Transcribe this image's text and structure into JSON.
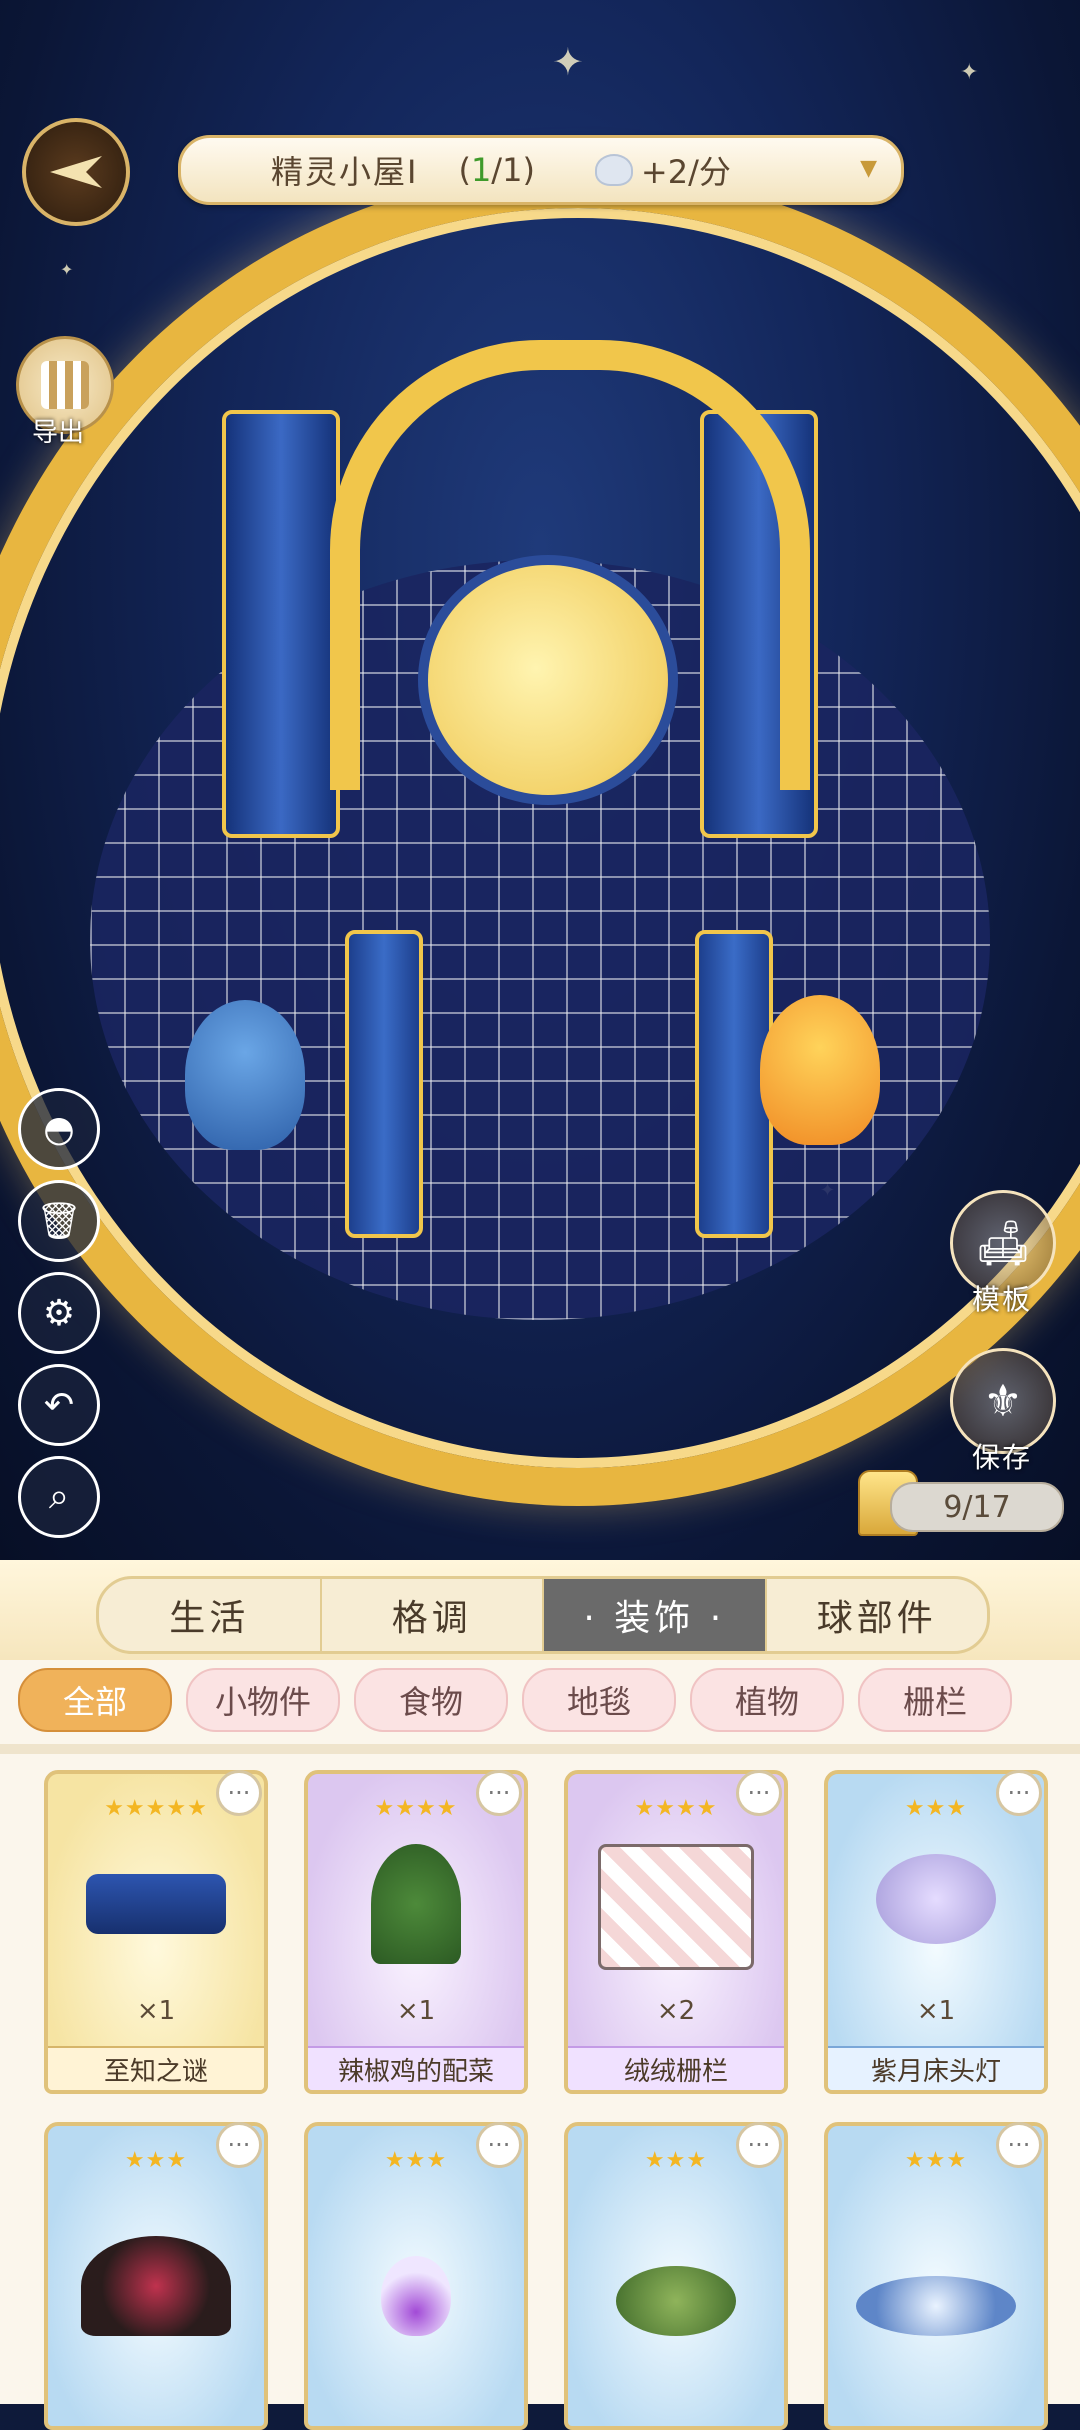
{
  "header": {
    "house_name": "精灵小屋Ⅰ",
    "count_open": "(",
    "count_current": "1",
    "count_rest": "/1)",
    "rate": "+2/分",
    "shell_icon": "shell-icon",
    "dropdown_icon": "chevron-down-icon"
  },
  "left_tools": {
    "export_label": "导出",
    "icons": [
      "back-icon",
      "qr-code-icon",
      "view-toggle-icon",
      "trash-icon",
      "gear-icon",
      "undo-icon",
      "search-icon"
    ]
  },
  "right_tools": {
    "template_label": "模板",
    "save_label": "保存"
  },
  "capacity": {
    "value": "9/17"
  },
  "tabs": [
    {
      "label": "生活"
    },
    {
      "label": "格调"
    },
    {
      "label": "· 装饰 ·"
    },
    {
      "label": "球部件"
    }
  ],
  "active_tab": 2,
  "subtabs": [
    {
      "label": "全部"
    },
    {
      "label": "小物件"
    },
    {
      "label": "食物"
    },
    {
      "label": "地毯"
    },
    {
      "label": "植物"
    },
    {
      "label": "栅栏"
    }
  ],
  "active_subtab": 0,
  "items": [
    {
      "name": "至知之谜",
      "qty": "×1",
      "stars": "★★★★★",
      "theme": "gold",
      "icon": "blue-mask-icon"
    },
    {
      "name": "辣椒鸡的配菜",
      "qty": "×1",
      "stars": "★★★★",
      "theme": "purple",
      "icon": "chili-plant-icon"
    },
    {
      "name": "绒绒栅栏",
      "qty": "×2",
      "stars": "★★★★",
      "theme": "purple",
      "icon": "card-fence-icon"
    },
    {
      "name": "紫月床头灯",
      "qty": "×1",
      "stars": "★★★",
      "theme": "blue",
      "icon": "cloud-lamp-icon"
    },
    {
      "name": "",
      "qty": "",
      "stars": "★★★",
      "theme": "blue",
      "icon": "ornament-icon"
    },
    {
      "name": "",
      "qty": "",
      "stars": "★★★",
      "theme": "blue",
      "icon": "potion-bottle-icon"
    },
    {
      "name": "",
      "qty": "",
      "stars": "★★★",
      "theme": "blue",
      "icon": "matcha-cake-icon"
    },
    {
      "name": "",
      "qty": "",
      "stars": "★★★",
      "theme": "blue",
      "icon": "flower-rug-icon"
    }
  ],
  "more_glyph": "···",
  "colors": {
    "accent_gold": "#e8b640",
    "active_tab": "#6a6a6a",
    "active_subtab": "#f0b25a",
    "scene_bg": "#13265a"
  }
}
